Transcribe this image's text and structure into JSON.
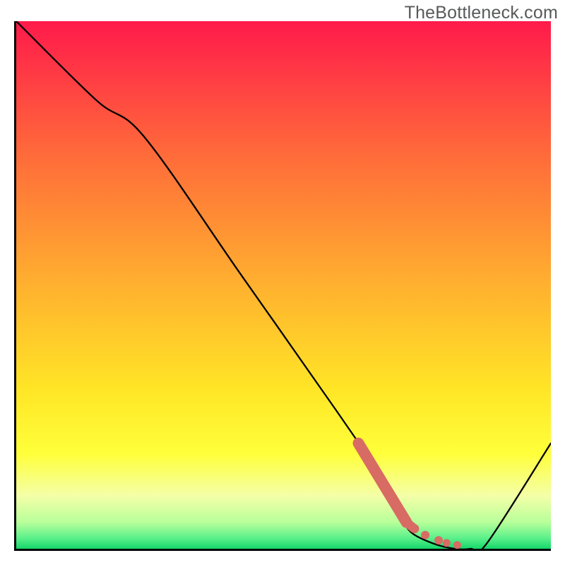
{
  "watermark": "TheBottleneck.com",
  "colors": {
    "grad_top": "#ff1a4b",
    "grad_mid1": "#ff803c",
    "grad_mid2": "#ffd426",
    "grad_yellow": "#ffff2a",
    "grad_pale": "#f3ffb0",
    "grad_green": "#18e06f",
    "curve": "#000000",
    "accent": "#d86b64"
  },
  "chart_data": {
    "type": "line",
    "title": "",
    "xlabel": "",
    "ylabel": "",
    "xlim": [
      0,
      100
    ],
    "ylim": [
      0,
      100
    ],
    "series": [
      {
        "name": "bottleneck-curve",
        "x": [
          0,
          15,
          24,
          42,
          60,
          70,
          72,
          74,
          78,
          82,
          85,
          88,
          100
        ],
        "y": [
          100,
          85,
          78,
          52,
          26,
          11,
          6,
          3,
          1,
          0,
          0,
          1,
          20
        ]
      },
      {
        "name": "accent-segment",
        "x": [
          64,
          73,
          74.5,
          76.5,
          79,
          80.5,
          82.5
        ],
        "y": [
          20,
          5,
          3.8,
          2.6,
          1.6,
          1.1,
          0.7
        ]
      }
    ],
    "annotations": []
  }
}
